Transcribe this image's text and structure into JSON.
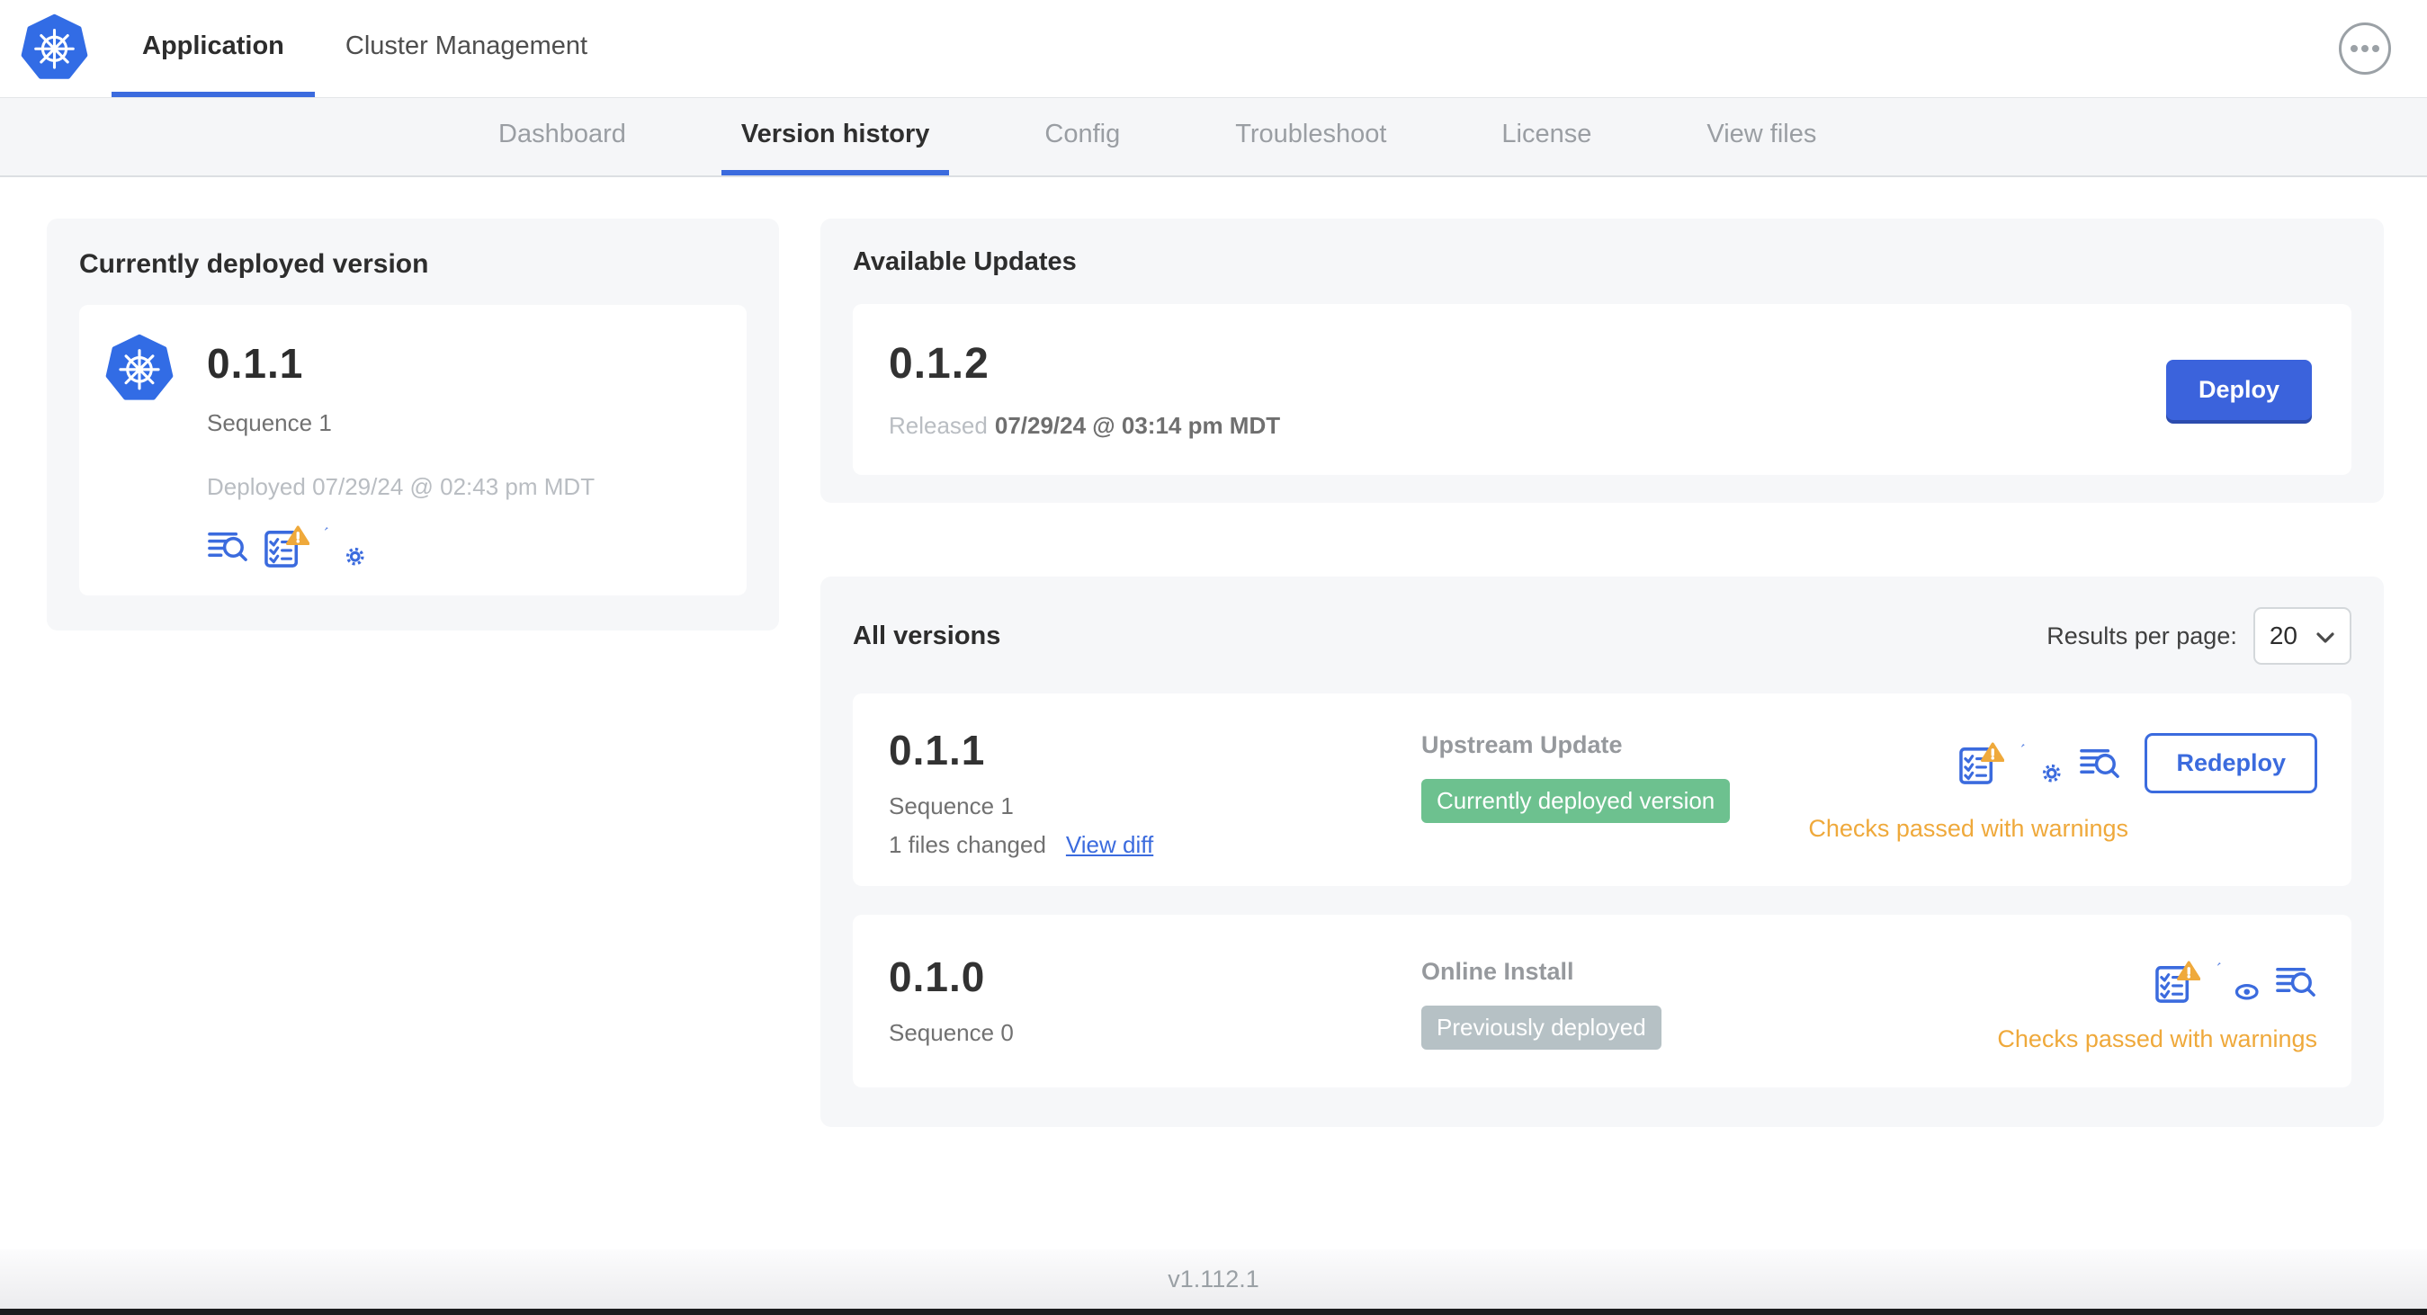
{
  "colors": {
    "accent_blue": "#3b6bde",
    "logo_blue": "#326ce5",
    "warning_orange": "#efa93b",
    "success_green": "#6dc18f",
    "muted_badge_gray": "#b6c1c5"
  },
  "header": {
    "logo_icon": "kubernetes-logo",
    "menu_icon": "ellipsis-icon",
    "tabs": [
      {
        "label": "Application",
        "active": true
      },
      {
        "label": "Cluster Management",
        "active": false
      }
    ]
  },
  "subnav": {
    "tabs": [
      {
        "label": "Dashboard",
        "active": false
      },
      {
        "label": "Version history",
        "active": true
      },
      {
        "label": "Config",
        "active": false
      },
      {
        "label": "Troubleshoot",
        "active": false
      },
      {
        "label": "License",
        "active": false
      },
      {
        "label": "View files",
        "active": false
      }
    ]
  },
  "current_version": {
    "title": "Currently deployed version",
    "version": "0.1.1",
    "sequence": "Sequence 1",
    "deployed": "Deployed 07/29/24 @ 02:43 pm MDT",
    "icons": [
      "release-notes-icon",
      "preflight-checks-warning-icon",
      "edit-config-icon"
    ]
  },
  "available_updates": {
    "title": "Available Updates",
    "version": "0.1.2",
    "released_prefix": "Released",
    "released_date": "07/29/24 @ 03:14 pm MDT",
    "deploy_label": "Deploy"
  },
  "all_versions": {
    "title": "All versions",
    "results_per_page_label": "Results per page:",
    "results_per_page_value": "20",
    "rows": [
      {
        "version": "0.1.1",
        "sequence": "Sequence 1",
        "files_changed": "1 files changed",
        "view_diff_label": "View diff",
        "source": "Upstream Update",
        "status_badge": "Currently deployed version",
        "status_color": "#6dc18f",
        "action_label": "Redeploy",
        "checks_text": "Checks passed with warnings",
        "icons": [
          "preflight-checks-warning-icon",
          "edit-config-icon",
          "release-notes-icon"
        ]
      },
      {
        "version": "0.1.0",
        "sequence": "Sequence 0",
        "source": "Online Install",
        "status_badge": "Previously deployed",
        "status_color": "#b6c1c5",
        "checks_text": "Checks passed with warnings",
        "icons": [
          "preflight-checks-warning-icon",
          "view-config-icon",
          "release-notes-icon"
        ]
      }
    ]
  },
  "footer": {
    "app_version": "v1.112.1"
  }
}
